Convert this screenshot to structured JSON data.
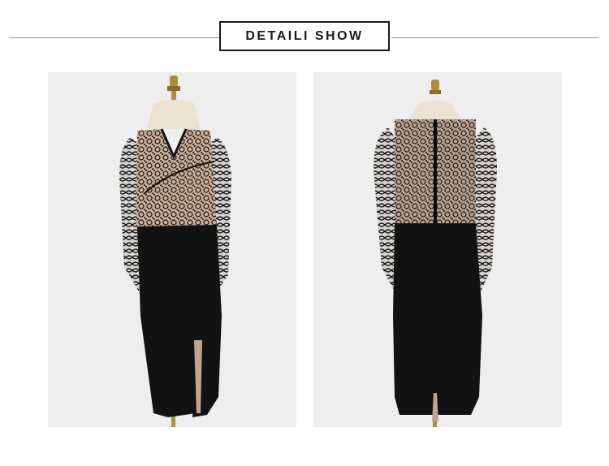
{
  "header": {
    "title": "DETAILI SHOW"
  },
  "images": [
    {
      "name": "dress-front-view",
      "icon": "dress-front-photo"
    },
    {
      "name": "dress-back-view",
      "icon": "dress-back-photo"
    }
  ],
  "colors": {
    "background": "#ffffff",
    "panel": "#eeeeee",
    "dress": "#121212",
    "lining": "#b89c88",
    "mannequin": "#e8dcc8",
    "brass": "#b08d3a"
  }
}
